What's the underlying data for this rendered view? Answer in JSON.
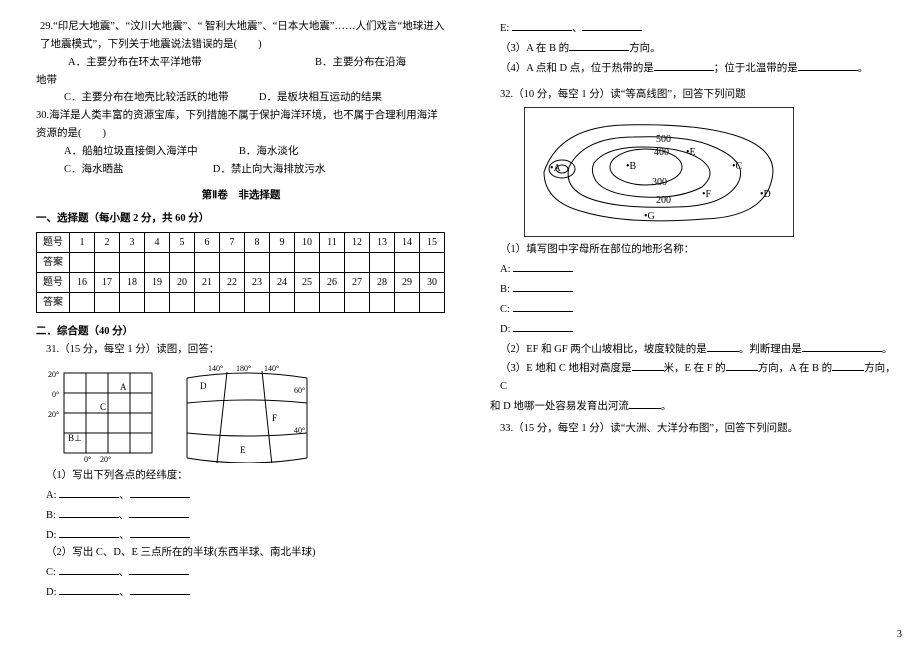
{
  "pagenum": "3",
  "q29": {
    "stem": "29.“印尼大地震”、“汶川大地震”、“ 智利大地震”、“日本大地震”……人们戏言“地球进入了地震模式”，下列关于地震说法错误的是(　　)",
    "A": "A．主要分布在环太平洋地带",
    "B": "B．主要分布在沿海",
    "line2": "地带",
    "C": "C．主要分布在地壳比较活跃的地带",
    "D": "D．是板块相互运动的结果"
  },
  "q30": {
    "stem": "30.海洋是人类丰富的资源宝库，下列措施不属于保护海洋环境，也不属于合理利用海洋资源的是(　　)",
    "A": "A．船舶垃圾直接倒入海洋中",
    "B": "B．海水淡化",
    "C": "C．海水晒盐",
    "D": "D．禁止向大海排放污水"
  },
  "part2": {
    "title": "第Ⅱ卷　非选择题"
  },
  "sec1": {
    "title": "一、选择题（每小题 2 分，共 60 分）"
  },
  "grid": {
    "r1": "题号",
    "r2": "答案",
    "n": [
      "1",
      "2",
      "3",
      "4",
      "5",
      "6",
      "7",
      "8",
      "9",
      "10",
      "11",
      "12",
      "13",
      "14",
      "15",
      "16",
      "17",
      "18",
      "19",
      "20",
      "21",
      "22",
      "23",
      "24",
      "25",
      "26",
      "27",
      "28",
      "29",
      "30"
    ]
  },
  "sec2": {
    "title": "二．综合题（40 分）"
  },
  "labels": {
    "A": "A:",
    "B": "B:",
    "C": "C:",
    "D": "D:",
    "E": "E:"
  },
  "q31": {
    "stem": "31.（15 分，每空 1 分）读图，回答：",
    "s1": "（1）写出下列各点的经纬度：",
    "s2": "（2）写出 C、D、E 三点所在的半球(东西半球、南北半球)",
    "s3a": "（3）A 在 B 的",
    "s3b": "方向。",
    "s4a": "（4）A 点和 D 点，位于热带的是",
    "s4b": "；位于北温带的是"
  },
  "q32": {
    "stem": "32.（10 分，每空 1 分）读“等高线图”，回答下列问题",
    "s1": "（1）填写图中字母所在部位的地形名称：",
    "s2a": "（2）EF 和 GF 两个山坡相比，坡度较陡的是",
    "s2b": "。判断理由是",
    "s3a": "（3）E 地和 C 地相对高度是",
    "s3b": "米，E 在 F 的",
    "s3c": "方向，A 在 B 的",
    "s3d": "方向，C",
    "s3e": "和 D 地哪一处容易发育出河流"
  },
  "q33": {
    "stem": "33.（15 分，每空 1 分）读“大洲、大洋分布图”，回答下列问题。"
  },
  "chart_data": {
    "type": "table",
    "title": "选择题答题表",
    "headers": [
      "题号",
      "答案"
    ],
    "rows": [
      1,
      2,
      3,
      4,
      5,
      6,
      7,
      8,
      9,
      10,
      11,
      12,
      13,
      14,
      15,
      16,
      17,
      18,
      19,
      20,
      21,
      22,
      23,
      24,
      25,
      26,
      27,
      28,
      29,
      30
    ]
  }
}
